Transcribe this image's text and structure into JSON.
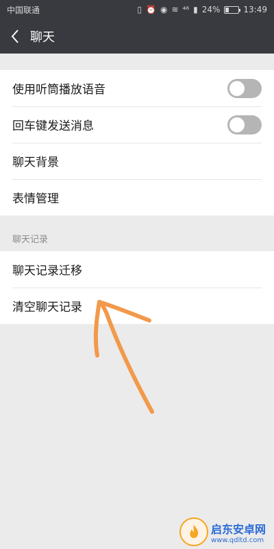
{
  "status_bar": {
    "carrier": "中国联通",
    "signal": "⁴⁶",
    "battery": "24%",
    "battery_level": 0.24,
    "time": "13:49"
  },
  "nav": {
    "title": "聊天"
  },
  "settings": {
    "group1": [
      {
        "label": "使用听筒播放语音",
        "has_toggle": true,
        "toggle_on": false
      },
      {
        "label": "回车键发送消息",
        "has_toggle": true,
        "toggle_on": false
      },
      {
        "label": "聊天背景",
        "has_toggle": false
      },
      {
        "label": "表情管理",
        "has_toggle": false
      }
    ],
    "section_header": "聊天记录",
    "group2": [
      {
        "label": "聊天记录迁移"
      },
      {
        "label": "清空聊天记录"
      }
    ]
  },
  "annotation": {
    "color": "#f2994a"
  },
  "watermark": {
    "title": "启东安卓网",
    "url": "www.qdltd.com"
  },
  "colors": {
    "header_bg": "#393a3f",
    "page_bg": "#ebebeb",
    "toggle_off": "#b5b5b5"
  }
}
